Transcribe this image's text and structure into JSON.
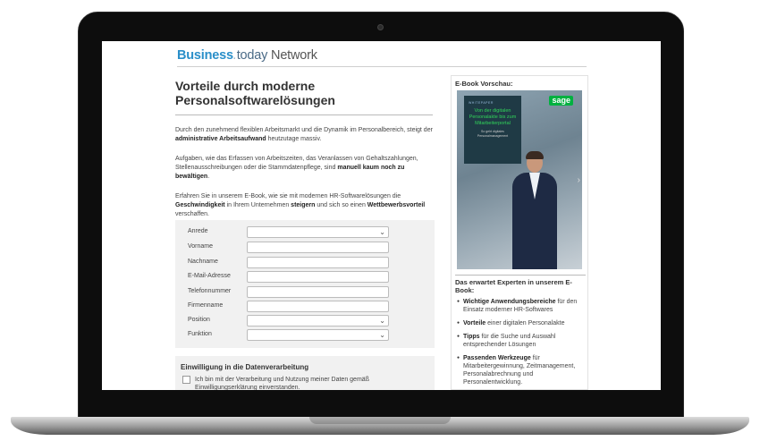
{
  "brand": {
    "business": "Business",
    "dot": ".",
    "today": "today",
    "network": "Network"
  },
  "headline": "Vorteile durch moderne Personalsoftwarelösungen",
  "paragraphs": {
    "p1_a": "Durch den zunehmend flexiblen Arbeitsmarkt und die Dynamik im Personalbereich, steigt der ",
    "p1_b": "administrative Arbeitsaufwand",
    "p1_c": " heutzutage massiv.",
    "p2_a": "Aufgaben, wie das Erfassen von Arbeitszeiten, das Veranlassen von Gehaltszahlungen, Stellenausschreibungen oder die Stammdatenpflege, sind ",
    "p2_b": "manuell kaum noch zu bewältigen",
    "p2_c": ".",
    "p3_a": "Erfahren Sie in unserem E-Book, wie sie mit modernen HR-Softwarelösungen die ",
    "p3_b": "Geschwindigkeit",
    "p3_c": " in Ihrem Unternehmen ",
    "p3_d": "steigern",
    "p3_e": " und sich so einen ",
    "p3_f": "Wettbewerbsvorteil",
    "p3_g": " verschaffen."
  },
  "form": {
    "fields": [
      {
        "label": "Anrede",
        "type": "select"
      },
      {
        "label": "Vorname",
        "type": "text"
      },
      {
        "label": "Nachname",
        "type": "text"
      },
      {
        "label": "E-Mail-Adresse",
        "type": "text"
      },
      {
        "label": "Telefonnummer",
        "type": "text"
      },
      {
        "label": "Firmenname",
        "type": "text"
      },
      {
        "label": "Position",
        "type": "select"
      },
      {
        "label": "Funktion",
        "type": "select"
      }
    ]
  },
  "consent": {
    "title": "Einwilligung in die Datenverarbeitung",
    "text": "Ich bin mit der Verarbeitung und Nutzung meiner Daten gemäß Einwilligungserklärung einverstanden."
  },
  "preview": {
    "title": "E-Book Vorschau:",
    "brand": "sage",
    "book_kicker": "WHITEPAPER",
    "book_title": "Von der digitalen Personalakte bis zum Mitarbeiterportal",
    "book_sub": "So geht digitales Personalmanagement"
  },
  "experts": {
    "title": "Das erwartet Experten in unserem E-Book:",
    "items": [
      {
        "strong": "Wichtige Anwendungsbereiche",
        "rest": " für den Einsatz moderner HR-Softwares"
      },
      {
        "strong": "Vorteile",
        "rest": " einer digitalen Personalakte"
      },
      {
        "strong": "Tipps",
        "rest": " für die Suche und Auswahl entsprechender Lösungen"
      },
      {
        "strong": "Passenden Werkzeuge",
        "rest": " für Mitarbeitergewinnung, Zeitmanagement, Personalabrechnung und Personalentwicklung."
      }
    ]
  }
}
